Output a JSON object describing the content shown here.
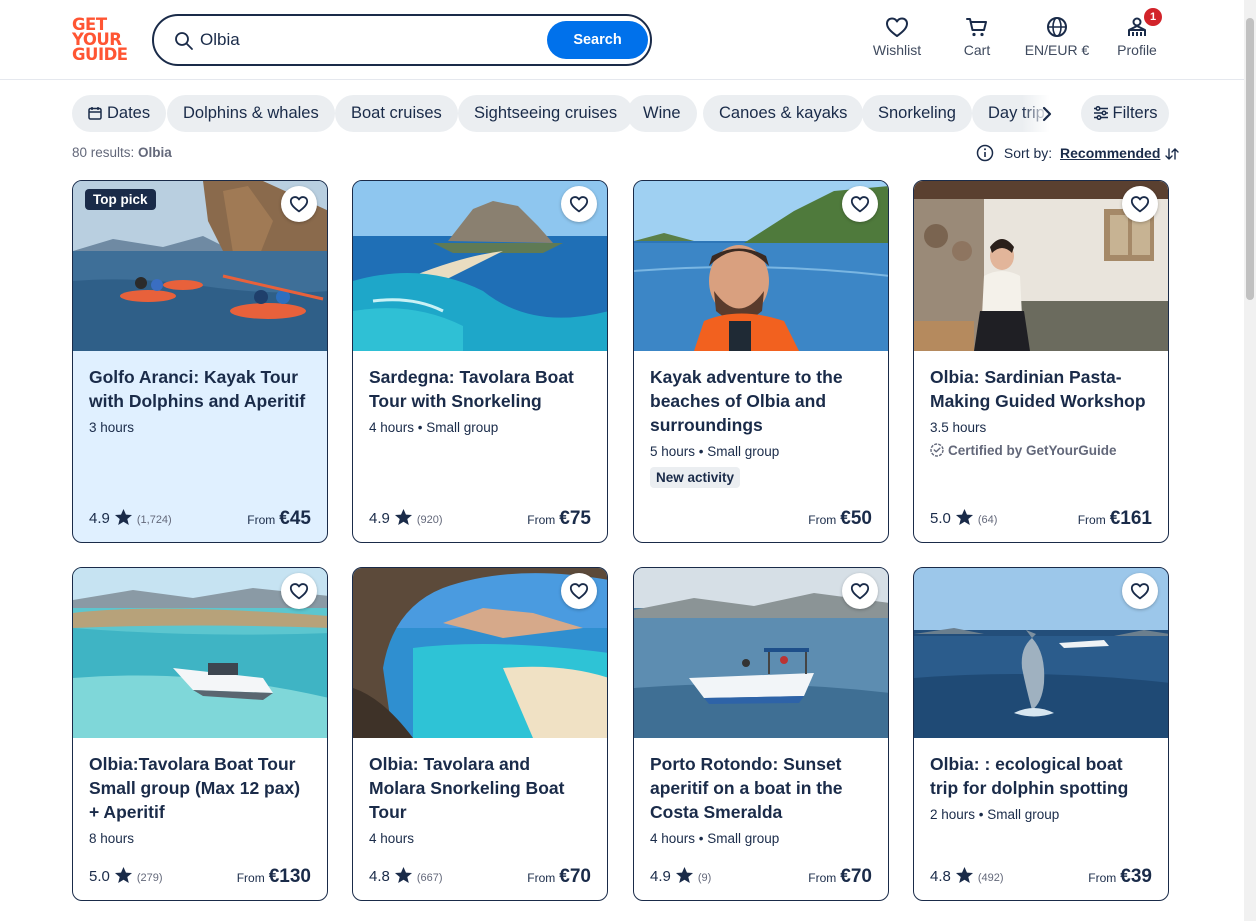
{
  "header": {
    "logo": [
      "GET",
      "YOUR",
      "GUIDE"
    ],
    "search_value": "Olbia",
    "search_button": "Search",
    "nav": {
      "wishlist": "Wishlist",
      "cart": "Cart",
      "language": "EN/EUR €",
      "profile": "Profile",
      "profile_badge": "1"
    }
  },
  "chips": [
    "Dates",
    "Dolphins & whales",
    "Boat cruises",
    "Sightseeing cruises",
    "Wine",
    "Canoes & kayaks",
    "Snorkeling",
    "Day trips"
  ],
  "filters_label": "Filters",
  "results": {
    "count_text": "80 results:",
    "query": "Olbia"
  },
  "sort": {
    "label": "Sort by:",
    "value": "Recommended"
  },
  "cards": [
    {
      "title": "Golfo Aranci: Kayak Tour with Dolphins and Aperitif",
      "meta": "3 hours",
      "badge": "Top pick",
      "rating": "4.9",
      "reviews": "(1,724)",
      "from": "From",
      "price": "€45"
    },
    {
      "title": "Sardegna: Tavolara Boat Tour with Snorkeling",
      "meta": "4 hours • Small group",
      "rating": "4.9",
      "reviews": "(920)",
      "from": "From",
      "price": "€75"
    },
    {
      "title": "Kayak adventure to the beaches of Olbia and surroundings",
      "meta": "5 hours • Small group",
      "tag": "New activity",
      "from": "From",
      "price": "€50"
    },
    {
      "title": "Olbia: Sardinian Pasta-Making Guided Workshop",
      "meta": "3.5 hours",
      "cert": "Certified by GetYourGuide",
      "rating": "5.0",
      "reviews": "(64)",
      "from": "From",
      "price": "€161"
    },
    {
      "title": "Olbia:Tavolara Boat Tour Small group (Max 12 pax) + Aperitif",
      "meta": "8 hours",
      "rating": "5.0",
      "reviews": "(279)",
      "from": "From",
      "price": "€130"
    },
    {
      "title": "Olbia: Tavolara and Molara Snorkeling Boat Tour",
      "meta": "4 hours",
      "rating": "4.8",
      "reviews": "(667)",
      "from": "From",
      "price": "€70"
    },
    {
      "title": "Porto Rotondo: Sunset aperitif on a boat in the Costa Smeralda",
      "meta": "4 hours • Small group",
      "rating": "4.9",
      "reviews": "(9)",
      "from": "From",
      "price": "€70"
    },
    {
      "title": "Olbia: : ecological boat trip for dolphin spotting",
      "meta": "2 hours • Small group",
      "rating": "4.8",
      "reviews": "(492)",
      "from": "From",
      "price": "€39"
    }
  ],
  "colors": {
    "brand": "#ff5533",
    "primary": "#0071eb",
    "text": "#1a2b49",
    "chip_bg": "#ebeef1",
    "highlight_card": "#e0f0ff",
    "badge": "#d2232a"
  }
}
